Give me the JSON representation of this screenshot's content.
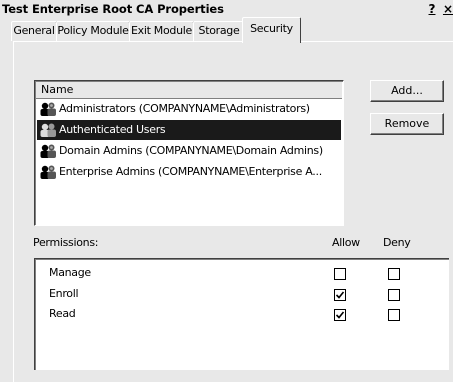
{
  "window": {
    "title": "Test Enterprise Root CA Properties",
    "help_label": "?",
    "close_label": "×"
  },
  "tabs": [
    {
      "label": "General",
      "active": false
    },
    {
      "label": "Policy Module",
      "active": false
    },
    {
      "label": "Exit Module",
      "active": false
    },
    {
      "label": "Storage",
      "active": false
    },
    {
      "label": "Security",
      "active": true
    }
  ],
  "users": {
    "header": "Name",
    "items": [
      {
        "label": "Administrators (COMPANYNAME\\Administrators)",
        "selected": false,
        "icon": "group-icon"
      },
      {
        "label": "Authenticated Users",
        "selected": true,
        "icon": "group-icon"
      },
      {
        "label": "Domain Admins (COMPANYNAME\\Domain Admins)",
        "selected": false,
        "icon": "group-icon"
      },
      {
        "label": "Enterprise Admins (COMPANYNAME\\Enterprise A...",
        "selected": false,
        "icon": "group-icon"
      }
    ]
  },
  "buttons": {
    "add_label": "Add...",
    "remove_label": "Remove"
  },
  "permissions": {
    "title": "Permissions:",
    "allow_label": "Allow",
    "deny_label": "Deny",
    "items": [
      {
        "label": "Manage",
        "allow": false,
        "deny": false
      },
      {
        "label": "Enroll",
        "allow": true,
        "deny": false
      },
      {
        "label": "Read",
        "allow": true,
        "deny": false
      }
    ]
  }
}
